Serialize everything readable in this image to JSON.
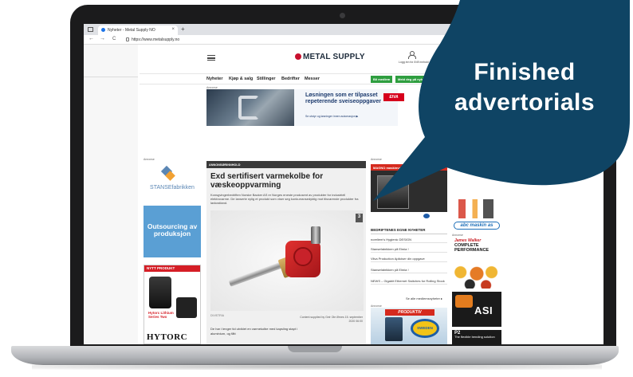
{
  "browser": {
    "tab_title": "Nyheter - Metal Supply NO",
    "tab_close": "×",
    "new_tab": "+",
    "back": "←",
    "forward": "→",
    "reload": "C",
    "url": "https://www.metalsupply.no"
  },
  "site": {
    "logo_text": "METAL SUPPLY",
    "login_text": "Logg inn for å få innhold",
    "menu": [
      "Nyheter",
      "Kjøp & salg",
      "Stillinger",
      "Bedrifter",
      "Messer"
    ],
    "green_buttons": [
      "Bli medlem",
      "Meld deg på nyheter"
    ],
    "ad_label": "Annonse"
  },
  "top_ad": {
    "headline": "Løsningen som er tilpasset repeterende sveiseoppgaver",
    "link": "Se utstyr og løsninger innen automasjon ▶",
    "brand": "EIVA"
  },
  "left_ads": {
    "stanse_text": "STANSEfabrikken",
    "outsourcing": "Outsourcing av produksjon",
    "hytorc_bar": "NYTT PRODUKT",
    "hytorc_sub": "Hytorc Lithium Series Two",
    "hytorc_logo": "HYTORC"
  },
  "article": {
    "category": "ANNONSØRINNHOLD",
    "title": "Exd sertifisert varmekolbe for væskeoppvarming",
    "lead": "Konsgvingerbedriften Norske Backer AS er Norges eneste produsent av produkter for industriell elektrovarme. De lanserte nylig et produkt som viser seg konkurransedyktig mot tilsvarende produkter fra lavkostland.",
    "image_count": "3",
    "source": "DIVISTRIA",
    "supplied": "Content supplied by Geir Ole Ørnes 15. september 2020 06:00",
    "body": "De har i lenger tid utviklet en varmekolbe med kapsling stapt i aluminium, og fått"
  },
  "mid_col": {
    "ad_top": "MAGNO maskinverksted",
    "news_heading": "BEDRIFTENES EGNE NYHETER",
    "news": [
      "noreliem's Hygienic DESIGN",
      "Stansefabrikken på Elmia !",
      "Vilva Production Apliciser din oppgave",
      "Stansefabrikken på Elmia !",
      "NEWS – Gigabit Ethernet Switches for Rolling Stock"
    ],
    "more": "Se alle medlemsnyheter ▸",
    "ad2_banner": "PRODUKTIV",
    "ad2_badge": "SWEDEN"
  },
  "right_col": {
    "abc_logo": "abc maskin as",
    "jw_logo": "James Walker",
    "jw_head": "COMPLETE PERFORMANCE",
    "asi_logo": "ASI",
    "p2_title": "P2",
    "p2_text": "The flexible bending solution"
  },
  "overlay": {
    "line1": "Finished",
    "line2": "advertorials",
    "color": "#0f4464"
  }
}
